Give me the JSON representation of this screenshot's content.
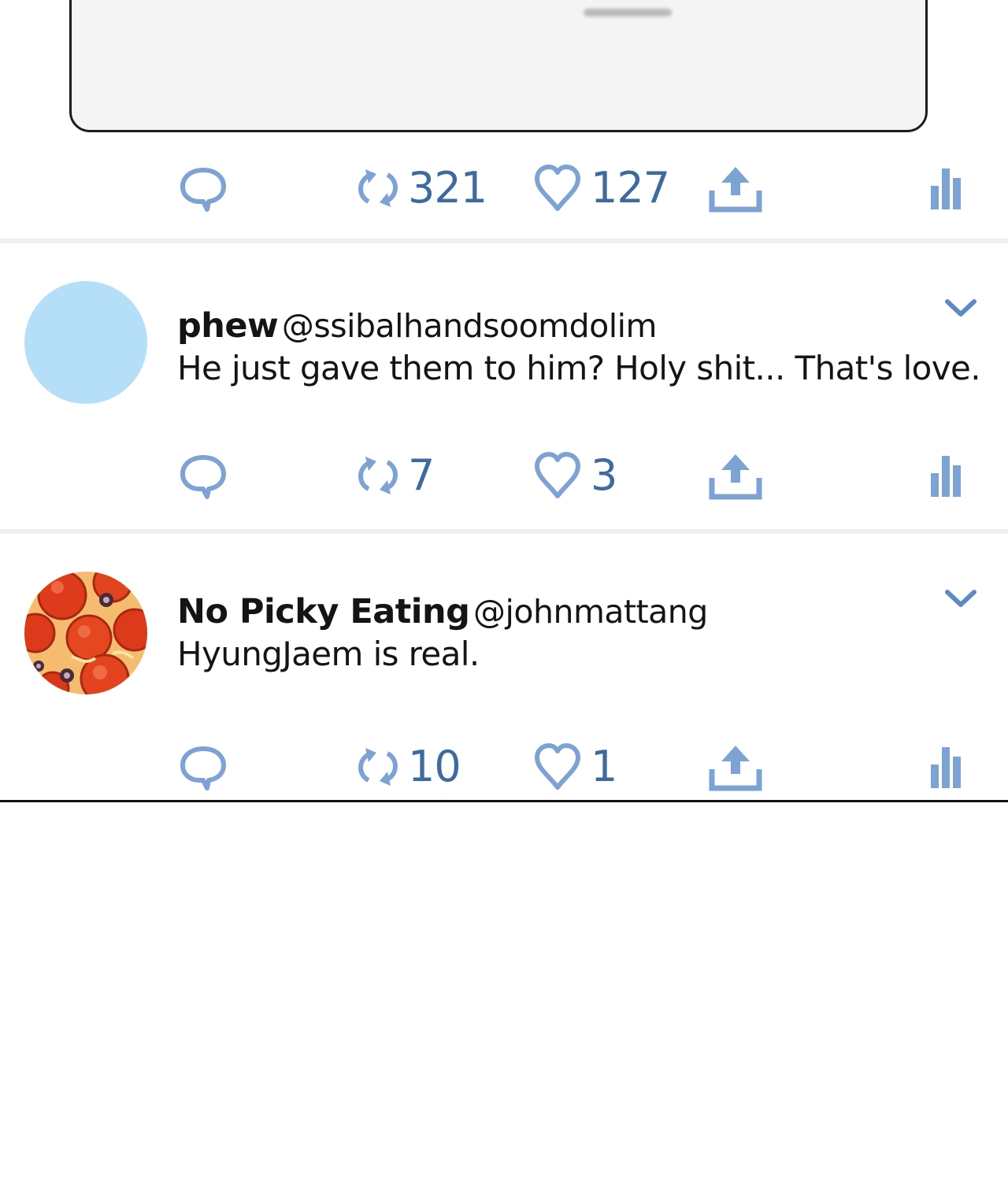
{
  "top_tweet": {
    "retweet_count": "321",
    "like_count": "127"
  },
  "replies": [
    {
      "display_name": "phew",
      "handle": "@ssibalhandsoomdolim",
      "text": "He just gave them to him? Holy shit... That's love.",
      "retweet_count": "7",
      "like_count": "3"
    },
    {
      "display_name": "No Picky Eating",
      "handle": "@johnmattang",
      "text": "HyungJaem is real.",
      "retweet_count": "10",
      "like_count": "1"
    }
  ],
  "colors": {
    "icon": "#7da3d4",
    "count": "#3d6ba0",
    "avatar_default": "#b5def9",
    "separator": "#eef1f3"
  },
  "icons": [
    "reply-icon",
    "retweet-icon",
    "like-icon",
    "share-icon",
    "stats-icon",
    "chevron-down-icon"
  ]
}
